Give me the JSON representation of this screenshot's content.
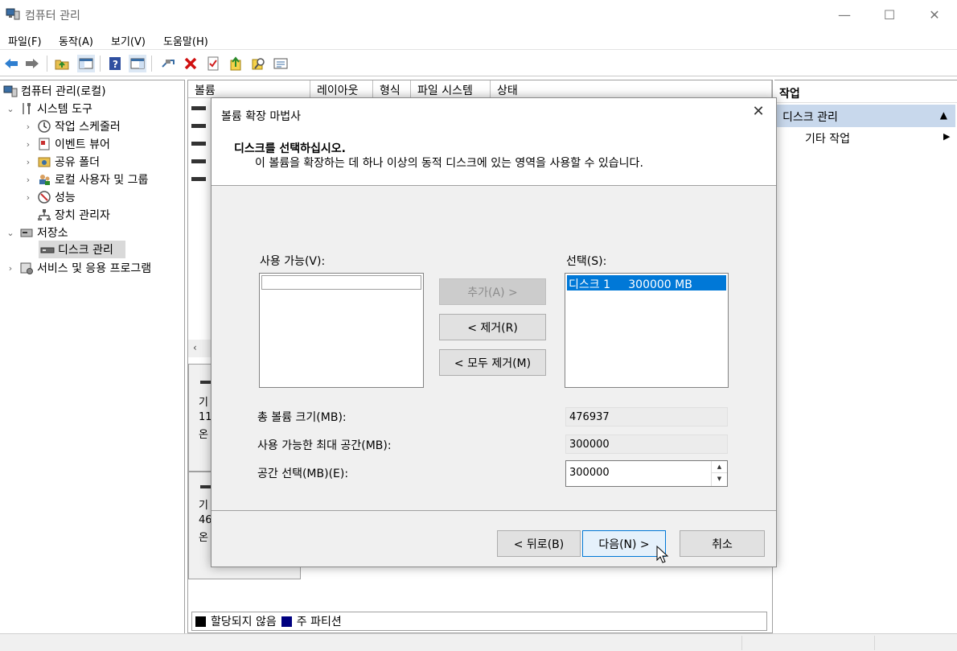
{
  "window": {
    "title": "컴퓨터 관리"
  },
  "menu": [
    "파일(F)",
    "동작(A)",
    "보기(V)",
    "도움말(H)"
  ],
  "tree": {
    "root": "컴퓨터 관리(로컬)",
    "system_tools": "시스템 도구",
    "items": [
      "작업 스케줄러",
      "이벤트 뷰어",
      "공유 폴더",
      "로컬 사용자 및 그룹",
      "성능",
      "장치 관리자"
    ],
    "storage": "저장소",
    "disk_mgmt": "디스크 관리",
    "services": "서비스 및 응용 프로그램"
  },
  "center": {
    "columns": [
      "볼륨",
      "레이아웃",
      "형식",
      "파일 시스템",
      "상태"
    ],
    "disk_panels": [
      {
        "line1": "기",
        "line2": "11",
        "line3": "온"
      },
      {
        "line1": "기",
        "line2": "46",
        "line3": "온"
      }
    ],
    "legend": {
      "unallocated": "할당되지 않음",
      "primary": "주 파티션",
      "unallocated_color": "#000000",
      "primary_color": "#000080"
    }
  },
  "actions": {
    "header": "작업",
    "selected": "디스크 관리",
    "other": "기타 작업"
  },
  "dialog": {
    "title": "볼륨 확장 마법사",
    "heading": "디스크를 선택하십시오.",
    "subtitle": "이 볼륨을 확장하는 데 하나 이상의 동적 디스크에 있는 영역을 사용할 수 있습니다.",
    "available_label": "사용 가능(V):",
    "selected_label": "선택(S):",
    "selected_items": [
      "디스크 1     300000 MB"
    ],
    "add_button": "추가(A) >",
    "remove_button": "< 제거(R)",
    "remove_all_button": "< 모두 제거(M)",
    "total_size_label": "총 볼륨 크기(MB):",
    "total_size_value": "476937",
    "max_space_label": "사용 가능한 최대 공간(MB):",
    "max_space_value": "300000",
    "select_space_label": "공간 선택(MB)(E):",
    "select_space_value": "300000",
    "back_button": "< 뒤로(B)",
    "next_button": "다음(N) >",
    "cancel_button": "취소"
  }
}
